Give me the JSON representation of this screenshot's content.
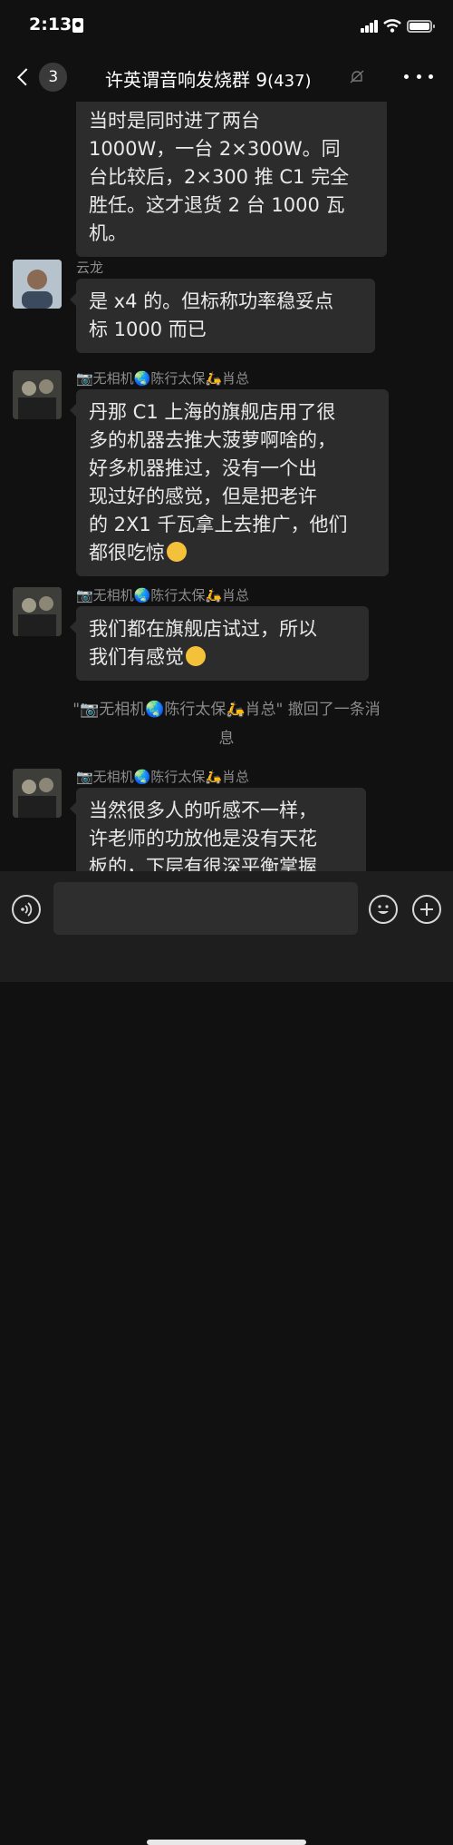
{
  "status_bar": {
    "time": "2:13"
  },
  "nav": {
    "unread_count": "3",
    "title": "许英谓音响发烧群 9",
    "member_count": "(437)"
  },
  "messages": [
    {
      "sender": "",
      "lines": [
        "当时是同时进了两台",
        "1000W，一台 2×300W。同",
        "台比较后，2×300 推 C1 完全",
        "胜任。这才退货 2 台 1000 瓦",
        "机。"
      ]
    },
    {
      "sender": "云龙",
      "lines": [
        "是 x4 的。但标称功率稳妥点",
        "标 1000 而已"
      ]
    },
    {
      "sender": "📷无相机🌏陈行太保🛵肖总",
      "lines": [
        "丹那 C1 上海的旗舰店用了很",
        "多的机器去推大菠萝啊啥的，",
        "好多机器推过，没有一个出",
        "现过好的感觉，但是把老许",
        "的 2X1 千瓦拿上去推广，他们",
        "都很吃惊"
      ]
    },
    {
      "sender": "📷无相机🌏陈行太保🛵肖总",
      "lines": [
        "我们都在旗舰店试过，所以",
        "我们有感觉"
      ]
    },
    {
      "system": [
        "\"📷无相机🌏陈行太保🛵肖总\" 撤回了一条消",
        "息"
      ]
    },
    {
      "sender": "📷无相机🌏陈行太保🛵肖总",
      "lines": [
        "当然很多人的听感不一样，",
        "许老师的功放他是没有天花",
        "板的，下层有很深平衡掌握"
      ]
    }
  ],
  "colors": {
    "background": "#111111",
    "bubble": "#2c2c2c",
    "input_bar": "#1e1e1e"
  },
  "icons": [
    "back-chevron-icon",
    "mute-bell-icon",
    "more-icon",
    "voice-icon",
    "emoji-icon",
    "plus-icon"
  ]
}
